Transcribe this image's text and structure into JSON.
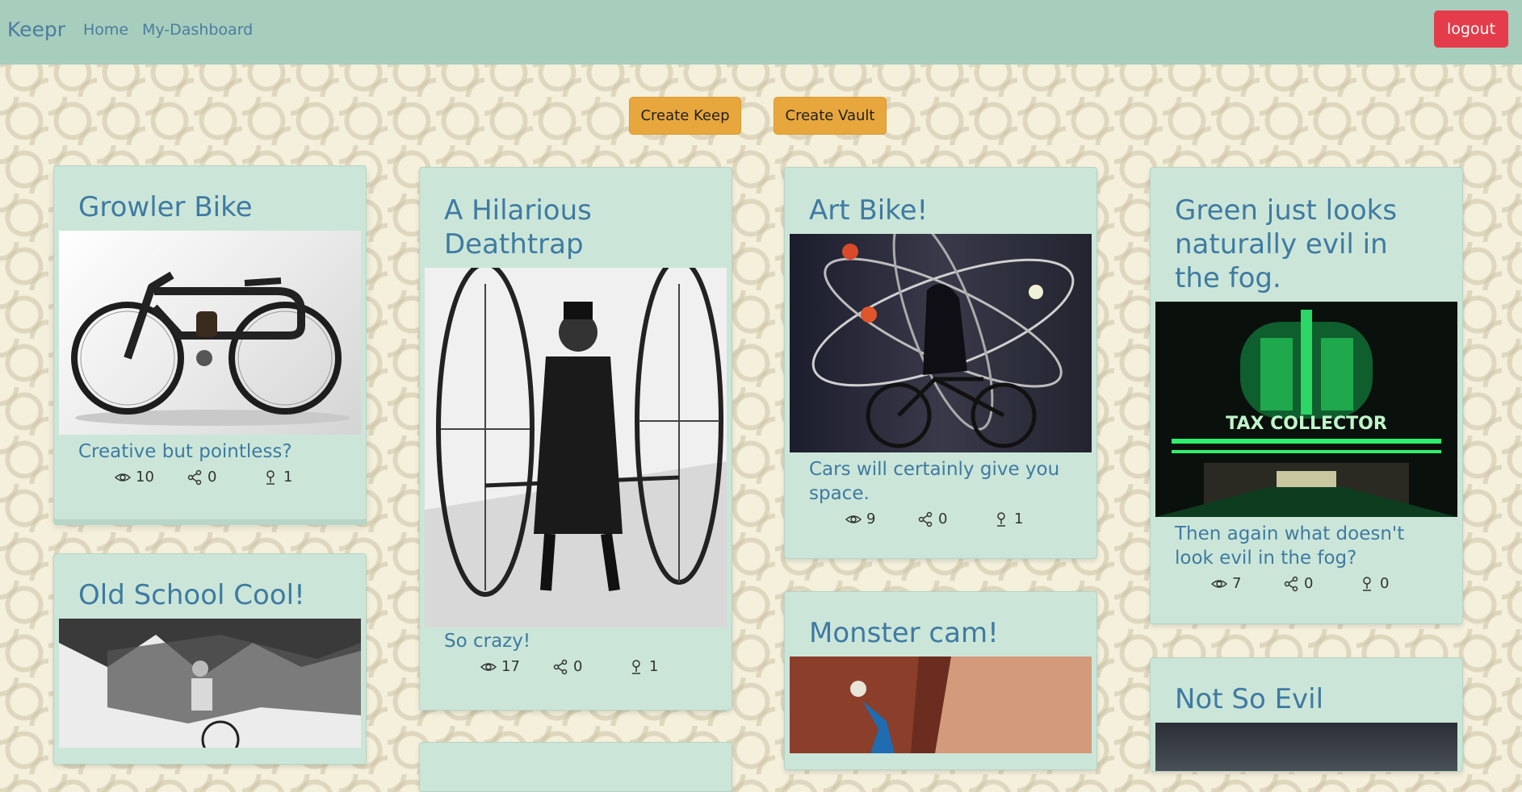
{
  "nav": {
    "brand": "Keepr",
    "links": [
      "Home",
      "My-Dashboard"
    ],
    "logout_label": "logout"
  },
  "actions": {
    "create_keep": "Create Keep",
    "create_vault": "Create Vault"
  },
  "keeps": [
    {
      "title": "Growler Bike",
      "description": "Creative but pointless?",
      "views": "10",
      "shares": "0",
      "keeps": "1"
    },
    {
      "title": "A Hilarious Deathtrap",
      "description": "So crazy!",
      "views": "17",
      "shares": "0",
      "keeps": "1"
    },
    {
      "title": "Art Bike!",
      "description": "Cars will certainly give you space.",
      "views": "9",
      "shares": "0",
      "keeps": "1"
    },
    {
      "title": "Green just looks naturally evil in the fog.",
      "description": "Then again what doesn't look evil in the fog?",
      "views": "7",
      "shares": "0",
      "keeps": "0"
    },
    {
      "title": "Old School Cool!"
    },
    {
      "title": "Monster cam!"
    },
    {
      "title": "Not So Evil"
    }
  ],
  "icons": {
    "views": "eye-icon",
    "shares": "share-icon",
    "keeps": "keep-pin-icon"
  },
  "colors": {
    "navbar": "#a7cdbd",
    "card": "#cbe6d8",
    "title": "#3f7aa2",
    "logout": "#e43c4a",
    "action": "#e8a73c"
  },
  "image_text": {
    "tax_sign": "TAX COLLECTOR"
  }
}
